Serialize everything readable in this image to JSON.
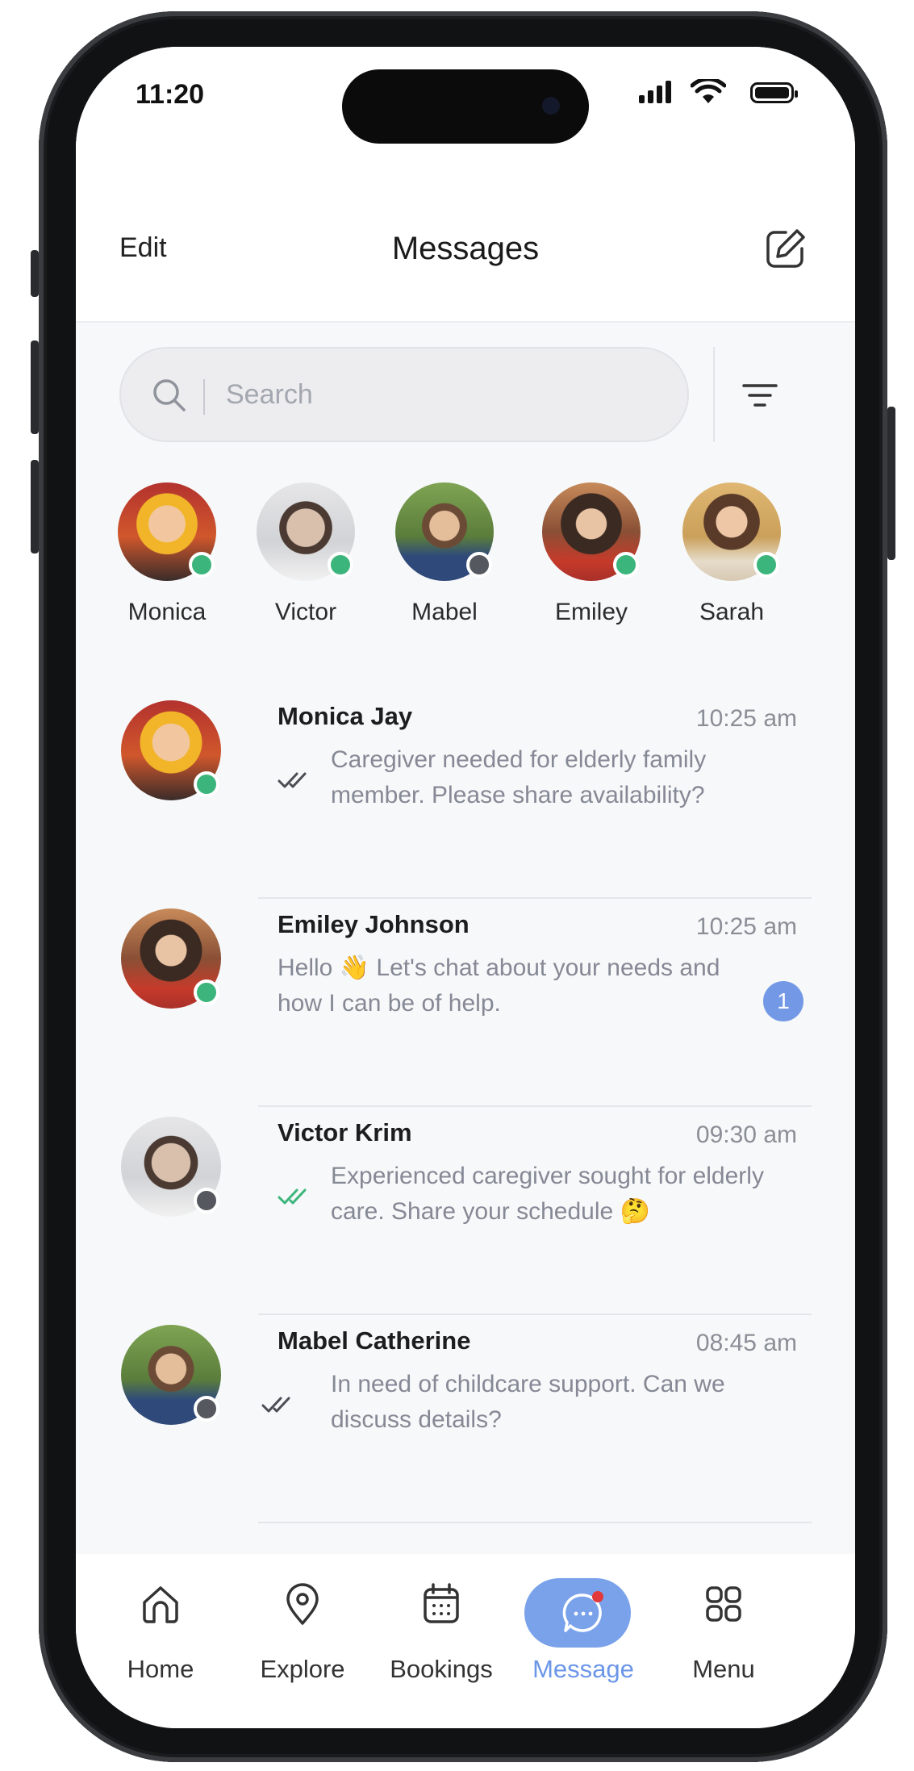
{
  "status_bar": {
    "time": "11:20"
  },
  "header": {
    "edit_label": "Edit",
    "title": "Messages"
  },
  "search": {
    "placeholder": "Search"
  },
  "stories": [
    {
      "name": "Monica",
      "online": true
    },
    {
      "name": "Victor",
      "online": true
    },
    {
      "name": "Mabel",
      "online": false
    },
    {
      "name": "Emiley",
      "online": true
    },
    {
      "name": "Sarah",
      "online": true
    }
  ],
  "conversations": [
    {
      "name": "Monica Jay",
      "time": "10:25 am",
      "message": "Caregiver needed for elderly family member. Please share availability?",
      "status": "delivered",
      "online": true
    },
    {
      "name": "Emiley Johnson",
      "time": "10:25 am",
      "message": "Hello 👋 Let's chat about your needs and how I can be of help.",
      "unread": "1",
      "online": true
    },
    {
      "name": "Victor Krim",
      "time": "09:30 am",
      "message": "Experienced caregiver sought for elderly care. Share your schedule 🤔",
      "status": "read",
      "online": false
    },
    {
      "name": "Mabel Catherine",
      "time": "08:45 am",
      "message": "In need of childcare support. Can we discuss details?",
      "status": "delivered",
      "online": false
    }
  ],
  "tabbar": {
    "items": [
      {
        "label": "Home",
        "icon": "home-icon"
      },
      {
        "label": "Explore",
        "icon": "location-pin-icon"
      },
      {
        "label": "Bookings",
        "icon": "calendar-icon"
      },
      {
        "label": "Message",
        "icon": "chat-bubble-icon",
        "active": true
      },
      {
        "label": "Menu",
        "icon": "grid-icon"
      }
    ]
  },
  "colors": {
    "accent": "#7aa2ea",
    "online": "#3bb57b",
    "offline": "#55585e",
    "read_check": "#3bb57b",
    "badge": "#7399e6"
  }
}
